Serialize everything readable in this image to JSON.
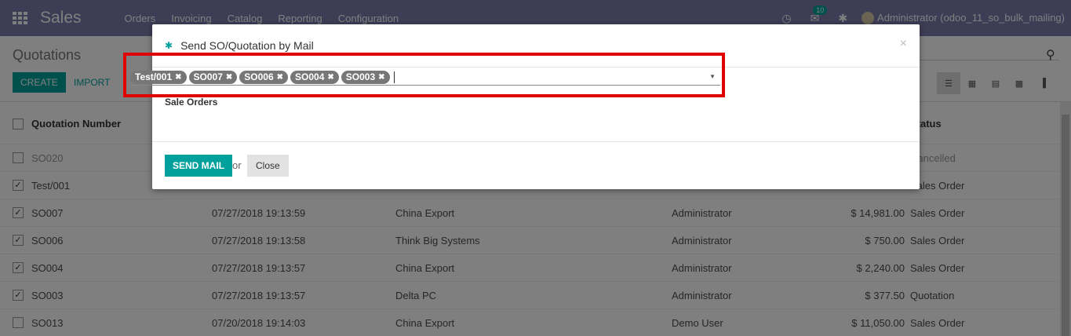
{
  "nav": {
    "brand": "Sales",
    "menu": [
      "Orders",
      "Invoicing",
      "Catalog",
      "Reporting",
      "Configuration"
    ],
    "chat_count": "10",
    "user": "Administrator (odoo_11_so_bulk_mailing)"
  },
  "control": {
    "breadcrumb": "Quotations",
    "create": "CREATE",
    "import": "IMPORT"
  },
  "table": {
    "headers": {
      "number": "Quotation Number",
      "status": "Status"
    },
    "rows": [
      {
        "number": "SO020",
        "date": "",
        "customer": "",
        "salesperson": "",
        "total": "",
        "status": "Cancelled",
        "checked": false
      },
      {
        "number": "Test/001",
        "date": "",
        "customer": "",
        "salesperson": "",
        "total": "",
        "status": "Sales Order",
        "checked": true
      },
      {
        "number": "SO007",
        "date": "07/27/2018 19:13:59",
        "customer": "China Export",
        "salesperson": "Administrator",
        "total": "$ 14,981.00",
        "status": "Sales Order",
        "checked": true
      },
      {
        "number": "SO006",
        "date": "07/27/2018 19:13:58",
        "customer": "Think Big Systems",
        "salesperson": "Administrator",
        "total": "$ 750.00",
        "status": "Sales Order",
        "checked": true
      },
      {
        "number": "SO004",
        "date": "07/27/2018 19:13:57",
        "customer": "China Export",
        "salesperson": "Administrator",
        "total": "$ 2,240.00",
        "status": "Sales Order",
        "checked": true
      },
      {
        "number": "SO003",
        "date": "07/27/2018 19:13:57",
        "customer": "Delta PC",
        "salesperson": "Administrator",
        "total": "$ 377.50",
        "status": "Quotation",
        "checked": true
      },
      {
        "number": "SO013",
        "date": "07/20/2018 19:14:03",
        "customer": "China Export",
        "salesperson": "Demo User",
        "total": "$ 11,050.00",
        "status": "Sales Order",
        "checked": false
      }
    ]
  },
  "modal": {
    "title": "Send SO/Quotation by Mail",
    "field_label": "Sale Orders",
    "tags": [
      "Test/001",
      "SO007",
      "SO006",
      "SO004",
      "SO003"
    ],
    "send": "SEND MAIL",
    "or": "or",
    "close": "Close"
  },
  "colors": {
    "brand": "#7c7bad",
    "accent": "#00a09d",
    "highlight": "#e00000"
  }
}
